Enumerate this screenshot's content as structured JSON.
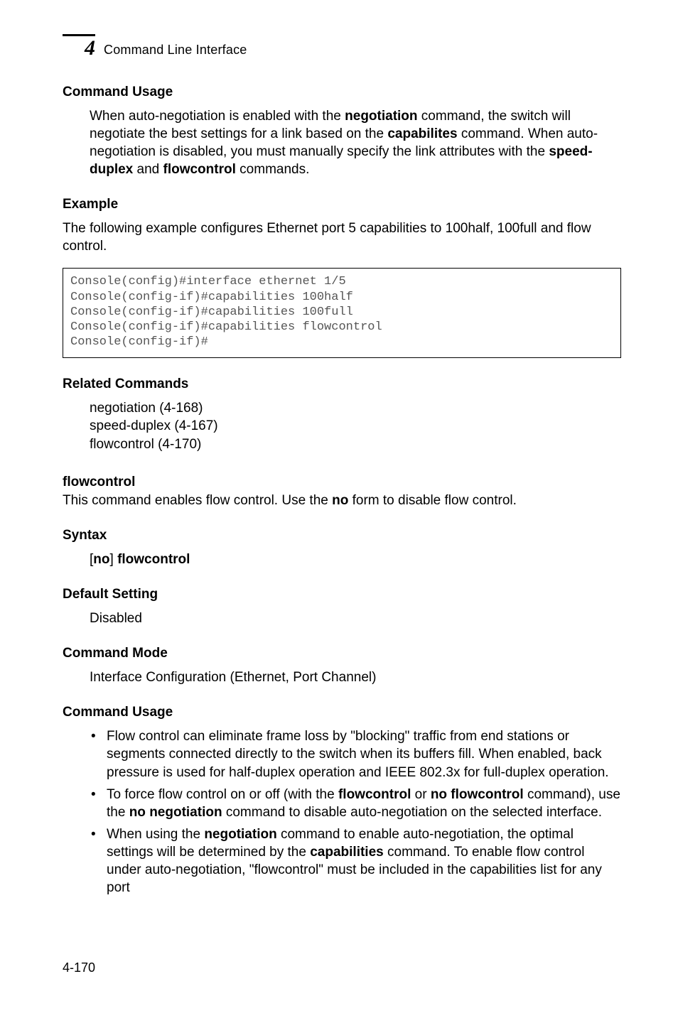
{
  "chapter_number": "4",
  "running_title": "Command Line Interface",
  "sec_cmd_usage1": "Command Usage",
  "para_cmd_usage1_pre": "When auto-negotiation is enabled with the ",
  "kw_negotiation": "negotiation",
  "para_cmd_usage1_mid1": " command, the switch will negotiate the best settings for a link based on the ",
  "kw_capabilites": "capabilites",
  "para_cmd_usage1_mid2": " command. When auto-negotiation is disabled, you must manually specify the link attributes with the ",
  "kw_speed_duplex": "speed-duplex",
  "para_cmd_usage1_mid3": " and ",
  "kw_flowcontrol": "flowcontrol",
  "para_cmd_usage1_end": " commands.",
  "sec_example": "Example",
  "para_example": "The following example configures Ethernet port 5 capabilities to 100half, 100full and flow control.",
  "code_lines": "Console(config)#interface ethernet 1/5\nConsole(config-if)#capabilities 100half\nConsole(config-if)#capabilities 100full\nConsole(config-if)#capabilities flowcontrol\nConsole(config-if)#",
  "sec_related": "Related Commands",
  "rel_line1": "negotiation (4-168)",
  "rel_line2": "speed-duplex (4-167)",
  "rel_line3": "flowcontrol (4-170)",
  "cmd_name": "flowcontrol",
  "cmd_desc_pre": "This command enables flow control. Use the ",
  "kw_no": "no",
  "cmd_desc_post": " form to disable flow control.",
  "sec_syntax": "Syntax",
  "syntax_br_open": "[",
  "syntax_no": "no",
  "syntax_br_close": "] ",
  "syntax_cmd": "flowcontrol",
  "sec_default": "Default Setting",
  "default_val": "Disabled",
  "sec_mode": "Command Mode",
  "mode_val": "Interface Configuration (Ethernet, Port Channel)",
  "sec_cmd_usage2": "Command Usage",
  "bul1": "Flow control can eliminate frame loss by \"blocking\" traffic from end stations or segments connected directly to the switch when its buffers fill. When enabled, back pressure is used for half-duplex operation and IEEE 802.3x for full-duplex operation.",
  "bul2_pre": "To force flow control on or off (with the ",
  "bul2_kw1": "flowcontrol",
  "bul2_mid1": " or ",
  "bul2_kw2": "no flowcontrol",
  "bul2_mid2": " command), use the ",
  "bul2_kw3": "no negotiation",
  "bul2_end": " command to disable auto-negotiation on the selected interface.",
  "bul3_pre": "When using the ",
  "bul3_kw1": "negotiation",
  "bul3_mid1": " command to enable auto-negotiation, the optimal settings will be determined by the ",
  "bul3_kw2": "capabilities",
  "bul3_end": " command. To enable flow control under auto-negotiation, \"flowcontrol\" must be included in the capabilities list for any port",
  "page_number": "4-170"
}
